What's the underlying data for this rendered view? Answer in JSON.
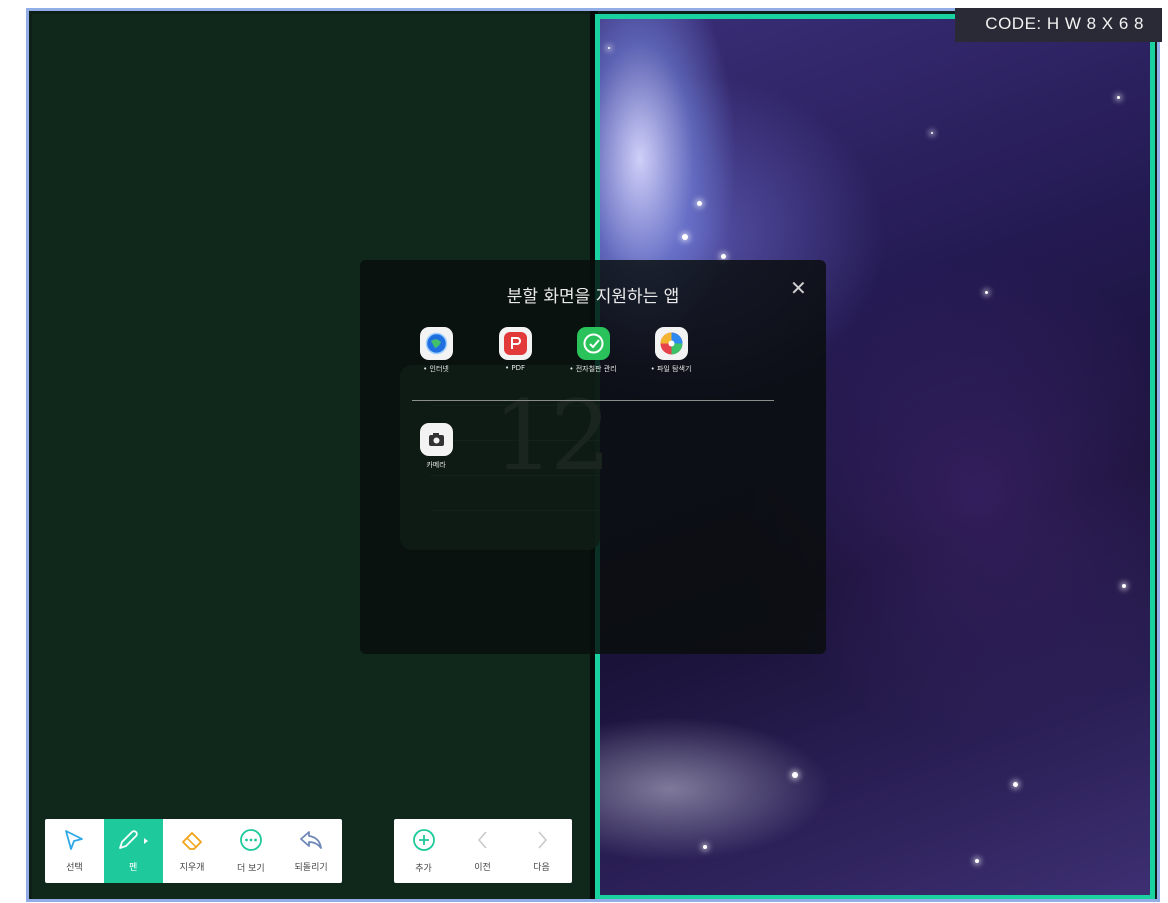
{
  "code_badge": "CODE: H W 8 X 6 8",
  "board_number": "12",
  "dialog": {
    "title": "분할 화면을 지원하는 앱",
    "close_glyph": "✕",
    "apps_row1": [
      {
        "label": "• 인터넷",
        "icon": "globe-icon"
      },
      {
        "label": "• PDF",
        "icon": "pdf-icon"
      },
      {
        "label": "• 전자칠판 관리",
        "icon": "board-manager-icon"
      },
      {
        "label": "• 파일 탐색기",
        "icon": "file-explorer-icon"
      }
    ],
    "apps_row2": [
      {
        "label": "카메라",
        "icon": "camera-icon"
      }
    ]
  },
  "toolbar_left": [
    {
      "label": "선택",
      "icon": "cursor-icon"
    },
    {
      "label": "펜",
      "icon": "pen-icon",
      "active": true
    },
    {
      "label": "지우개",
      "icon": "eraser-icon"
    },
    {
      "label": "더 보기",
      "icon": "more-icon"
    },
    {
      "label": "되돌리기",
      "icon": "undo-icon"
    }
  ],
  "toolbar_right": [
    {
      "label": "추가",
      "icon": "add-icon"
    },
    {
      "label": "이전",
      "icon": "prev-icon"
    },
    {
      "label": "다음",
      "icon": "next-icon"
    }
  ],
  "colors": {
    "accent": "#1ec99b",
    "right_pane_border": "#19d2a0",
    "frame_border": "#93aee6"
  }
}
